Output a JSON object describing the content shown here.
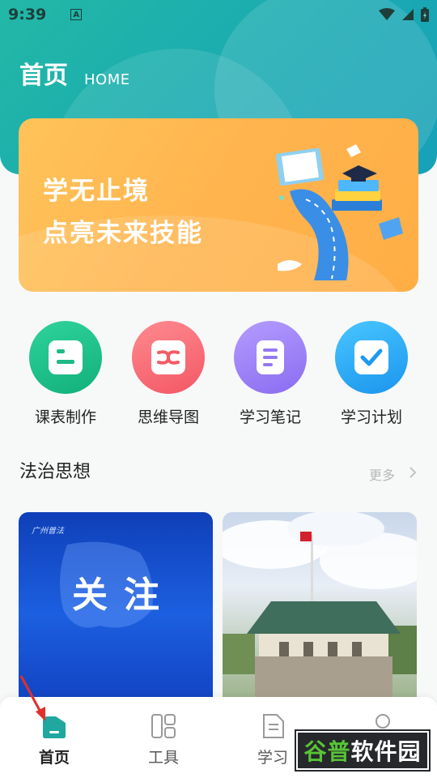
{
  "status": {
    "time": "9:39",
    "notification_letter": "A"
  },
  "header": {
    "title": "首页",
    "subtitle": "HOME"
  },
  "banner": {
    "line1": "学无止境",
    "line2": "点亮未来技能"
  },
  "quick_actions": [
    {
      "label": "课表制作",
      "icon": "schedule-icon",
      "color": "#1fc18a"
    },
    {
      "label": "思维导图",
      "icon": "mindmap-icon",
      "color": "#f76d77"
    },
    {
      "label": "学习笔记",
      "icon": "notes-icon",
      "color": "#9f84f5"
    },
    {
      "label": "学习计划",
      "icon": "checklist-icon",
      "color": "#2ba8f4"
    }
  ],
  "section": {
    "title": "法治思想",
    "more": "更多"
  },
  "cards": [
    {
      "tag": "广州普法",
      "text": "关注"
    }
  ],
  "tabbar": {
    "items": [
      {
        "label": "首页",
        "active": true
      },
      {
        "label": "工具",
        "active": false
      },
      {
        "label": "学习",
        "active": false
      }
    ]
  },
  "watermark": {
    "brand": "谷普",
    "text": "软件园"
  },
  "colors": {
    "accent": "#1fb3a8",
    "banner": "#ffb84f"
  }
}
